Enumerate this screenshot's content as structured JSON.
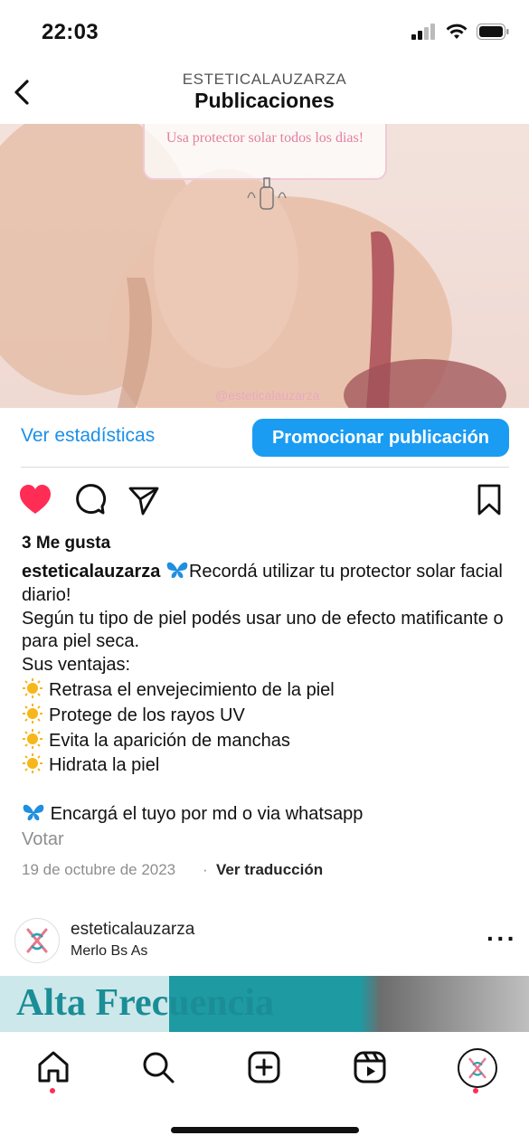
{
  "status_bar": {
    "time": "22:03"
  },
  "header": {
    "account": "ESTETICALAUZARZA",
    "title": "Publicaciones"
  },
  "post": {
    "image_card_text": "Usa protector solar todos los dias!",
    "image_watermark": "@esteticalauzarza",
    "stats_label": "Ver estadísticas",
    "promote_label": "Promocionar publicación",
    "likes": "3 Me gusta",
    "username": "esteticalauzarza",
    "caption_lines": [
      "Recordá utilizar tu protector solar facial diario!",
      "Según tu tipo de piel podés usar uno de efecto matificante o para piel seca.",
      "Sus ventajas:"
    ],
    "benefits": [
      "Retrasa el envejecimiento de la piel",
      "Protege de los rayos UV",
      "Evita la aparición de manchas",
      "Hidrata la piel"
    ],
    "order_line": "Encargá el tuyo por md o via whatsapp",
    "vote": "Votar",
    "date": "19 de octubre de 2023",
    "separator": "·",
    "translate": "Ver traducción",
    "liked": true
  },
  "next_post": {
    "username": "esteticalauzarza",
    "location": "Merlo Bs As",
    "image_title": "Alta Frecuencia"
  },
  "colors": {
    "accent": "#1a9cf3",
    "like": "#ff2d55",
    "link": "#1a8fe8"
  }
}
